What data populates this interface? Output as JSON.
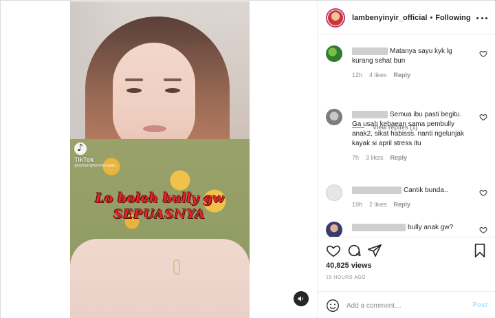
{
  "header": {
    "username": "lambenyinyir_official",
    "separator": "•",
    "follow_status": "Following"
  },
  "video": {
    "tiktok_label": "TikTok",
    "tiktok_handle": "@ashantyhermansyah",
    "caption_line1": "Lo boleh bully gw",
    "caption_line2": "SEPUASNYA"
  },
  "comments": [
    {
      "text": "Matanya sayu kyk lg kurang sehat bun",
      "time": "12h",
      "likes": "4 likes",
      "reply": "Reply"
    },
    {
      "text": "Semua ibu pasti begitu. Ga usah kebaean sama pembully anak2, sikat habisss. nanti ngelunjak kayak si april stress itu",
      "time": "7h",
      "likes": "3 likes",
      "reply": "Reply"
    },
    {
      "text": "Cantik bunda..",
      "time": "19h",
      "likes": "2 likes",
      "reply": "Reply"
    },
    {
      "text": "bully anak gw?",
      "time": "",
      "likes": "",
      "reply": ""
    }
  ],
  "view_replies": "View replies (1)",
  "stats": {
    "views": "40,825 views",
    "time_ago": "19 HOURS AGO"
  },
  "add_comment": {
    "placeholder": "Add a comment…",
    "post_label": "Post"
  },
  "colors": {
    "text": "#262626",
    "muted": "#8e8e8e",
    "border": "#efefef",
    "post_button": "#b2dffc",
    "caption_red": "#e3262b"
  }
}
